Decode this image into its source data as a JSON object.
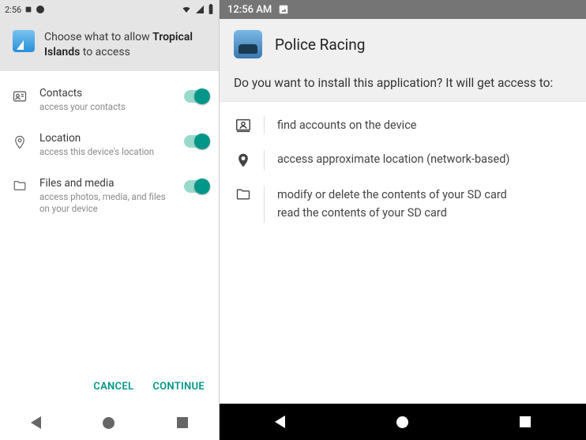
{
  "left": {
    "statusbar": {
      "time": "2:56",
      "icons": [
        "notification-icon",
        "dnd-icon",
        "wifi-icon",
        "signal-icon",
        "battery-icon"
      ]
    },
    "header": {
      "prefix": "Choose what to allow ",
      "app_name": "Tropical Islands",
      "suffix": " to access"
    },
    "permissions": [
      {
        "icon": "contacts-icon",
        "title": "Contacts",
        "desc": "access your contacts",
        "enabled": true
      },
      {
        "icon": "location-icon",
        "title": "Location",
        "desc": "access this device's location",
        "enabled": true
      },
      {
        "icon": "folder-icon",
        "title": "Files and media",
        "desc": "access photos, media, and files on your device",
        "enabled": true
      }
    ],
    "footer": {
      "cancel": "CANCEL",
      "continue": "CONTINUE"
    }
  },
  "right": {
    "statusbar": {
      "time": "12:56 AM"
    },
    "title": "Police Racing",
    "question": "Do you want to install this application? It will get access to:",
    "permissions": [
      {
        "icon": "accounts-icon",
        "lines": [
          "find accounts on the device"
        ]
      },
      {
        "icon": "location-icon",
        "lines": [
          "access approximate location (network-based)"
        ]
      },
      {
        "icon": "folder-icon",
        "lines": [
          "modify or delete the contents of your SD card",
          "read the contents of your SD card"
        ]
      }
    ]
  },
  "colors": {
    "accent_teal": "#009688",
    "grey_bg": "#e5e5e5",
    "dark_grey": "#757575"
  }
}
